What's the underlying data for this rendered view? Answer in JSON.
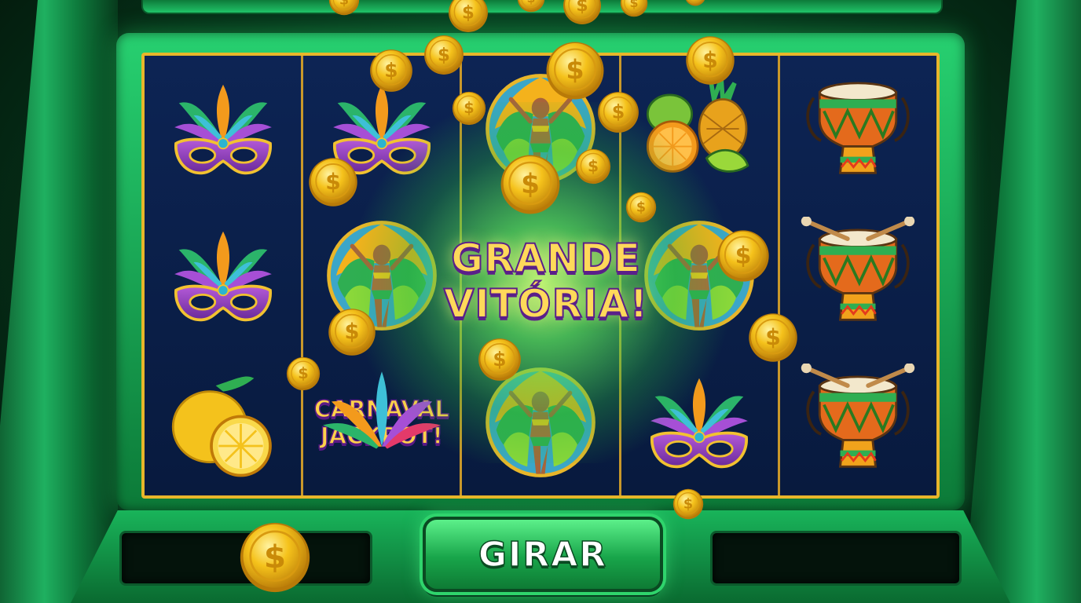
{
  "game": {
    "banner_line1": "GRANDE",
    "banner_line2": "VITÓRIA!",
    "jackpot_line1": "CARNAVAL",
    "jackpot_line2": "JACKPOT!",
    "spin_label": "GIRAR",
    "coin_symbol": "$"
  },
  "reels": [
    [
      "feather-mask",
      "feather-mask",
      "lemon"
    ],
    [
      "feather-mask",
      "samba-dancer",
      "carnaval-jackpot"
    ],
    [
      "samba-dancer",
      "big-win-glow",
      "samba-dancer"
    ],
    [
      "fruit-pile",
      "samba-dancer",
      "feather-mask"
    ],
    [
      "drum",
      "drum",
      "drum"
    ]
  ],
  "colors": {
    "cabinet_green": "#1fb060",
    "reel_frame_gold": "#e8b62a",
    "reel_background": "#0b1f4a",
    "banner_gold": "#ffd95a",
    "banner_outline": "#5a1f8a",
    "coin_gold": "#f5c21b"
  }
}
